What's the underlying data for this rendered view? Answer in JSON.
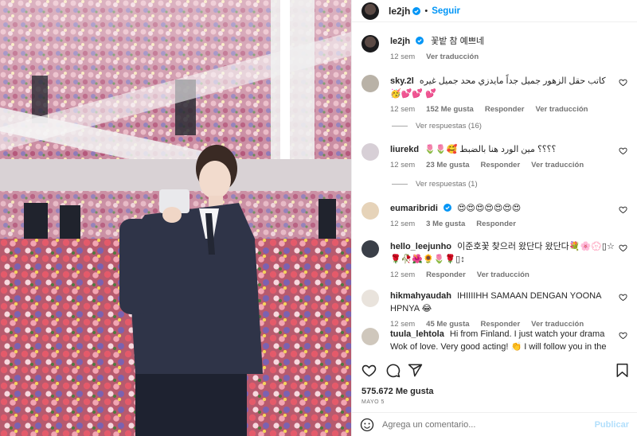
{
  "header": {
    "username": "le2jh",
    "separator": "•",
    "follow_label": "Seguir"
  },
  "caption": {
    "username": "le2jh",
    "text": "꽃밭 참 예쁘네",
    "time": "12 sem",
    "translate": "Ver traducción"
  },
  "comments": [
    {
      "username": "sky.2l",
      "text": "كاتب حقل الزهور جميل جداً مايدزي محد جميل غيره 🥳💕💕 💕",
      "time": "12 sem",
      "likes": "152 Me gusta",
      "reply": "Responder",
      "translate": "Ver traducción",
      "view_replies": "Ver respuestas (16)"
    },
    {
      "username": "liurekd",
      "text": "🌷🌷🥰 ؟؟؟؟ مين الورد هنا بالضبط",
      "time": "12 sem",
      "likes": "23 Me gusta",
      "reply": "Responder",
      "translate": "Ver traducción",
      "view_replies": "Ver respuestas (1)"
    },
    {
      "username": "eumaribridi",
      "text": "😍😍😍😍😍😍😍",
      "time": "12 sem",
      "likes": "3 Me gusta",
      "reply": "Responder"
    },
    {
      "username": "hello_leejunho",
      "text": "이준호꽃 찾으러 왔단다 왔단다💐🌸💮▯☆🌹🥀🌺🌻🌷🌹▯↕",
      "time": "12 sem",
      "likes": "",
      "reply": "Responder",
      "translate": "Ver traducción"
    },
    {
      "username": "hikmahyaudah",
      "text": "IHIIIIHH SAMAAN DENGAN YOONA HPNYA 😂",
      "time": "12 sem",
      "likes": "45 Me gusta",
      "reply": "Responder",
      "translate": "Ver traducción"
    },
    {
      "username": "tuula_lehtola",
      "text": "Hi from Finland. I just watch your drama Wok of love. Very good acting! 👏 I will follow you in the future",
      "time": "",
      "likes": "",
      "reply": ""
    }
  ],
  "post": {
    "likes": "575.672 Me gusta",
    "date": "MAYO 5"
  },
  "composer": {
    "placeholder": "Agrega un comentario...",
    "post_label": "Publicar"
  },
  "colors": {
    "accent": "#0095f6",
    "text": "#262626",
    "muted": "#737373",
    "verified": "#0095f6"
  },
  "icons": [
    "verified-badge-icon",
    "heart-icon",
    "comment-icon",
    "share-icon",
    "bookmark-icon",
    "emoji-icon"
  ]
}
